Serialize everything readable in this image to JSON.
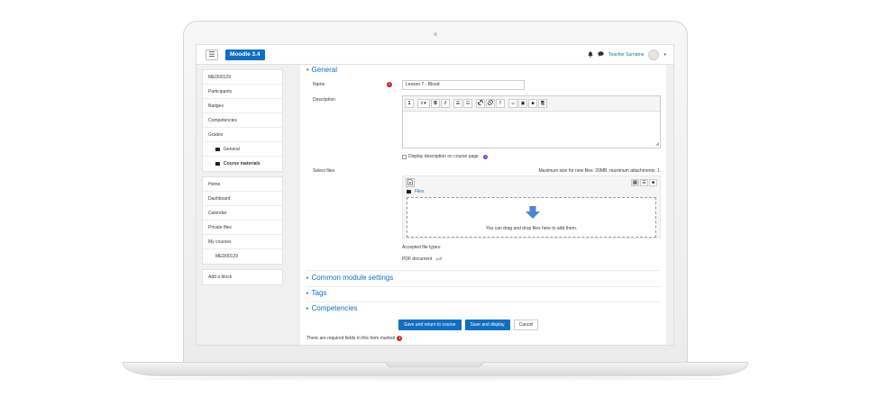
{
  "navbar": {
    "menu_icon": "☰",
    "brand": "Moodle 3.4",
    "notification_icon": "bell-icon",
    "message_icon": "chat-icon",
    "user_name": "Teacher Surname",
    "user_menu_caret": "▾"
  },
  "drawer": {
    "course_items": [
      {
        "label": "MED00129"
      },
      {
        "label": "Participants"
      },
      {
        "label": "Badges"
      },
      {
        "label": "Competencies"
      },
      {
        "label": "Grades"
      },
      {
        "label": "General"
      },
      {
        "label": "Course materials"
      }
    ],
    "site_items": [
      {
        "label": "Home"
      },
      {
        "label": "Dashboard"
      },
      {
        "label": "Calendar"
      },
      {
        "label": "Private files"
      },
      {
        "label": "My courses"
      },
      {
        "label": "MED00129"
      }
    ],
    "add_block": "Add a block"
  },
  "form": {
    "general_header": "General",
    "name_label": "Name",
    "name_value": "Lesson 7 - Blood",
    "required_icon": "!",
    "description_label": "Description",
    "toolbar": {
      "collapse": "1",
      "info": "i ▾",
      "bold": "B",
      "italic": "I",
      "ul": "☰",
      "ol": "☷",
      "link": "🔗",
      "unlink": "⛓",
      "warning": "!",
      "emoji": "☺",
      "image": "▣",
      "video": "■",
      "manage_files": "⎘"
    },
    "display_description": "Display description on course page",
    "help_icon": "?",
    "select_files_label": "Select files",
    "max_size": "Maximum size for new files: 20MB, maximum attachments: 1",
    "add_file_icon": "⎗",
    "view_icons": [
      "▦",
      "☰",
      "■"
    ],
    "files_link": "Files",
    "drop_text": "You can drag and drop files here to add them.",
    "accepted_types": "Accepted file types:",
    "pdf_document": "PDF document",
    "pdf_ext": ".pdf",
    "collapsed_sections": [
      {
        "label": "Common module settings"
      },
      {
        "label": "Tags"
      },
      {
        "label": "Competencies"
      }
    ],
    "buttons": {
      "save_return": "Save and return to course",
      "save_display": "Save and display",
      "cancel": "Cancel"
    },
    "required_note": "There are required fields in this form marked"
  },
  "colors": {
    "brand": "#0f6fc5",
    "required": "#c62828",
    "help": "#7a3fb8"
  }
}
